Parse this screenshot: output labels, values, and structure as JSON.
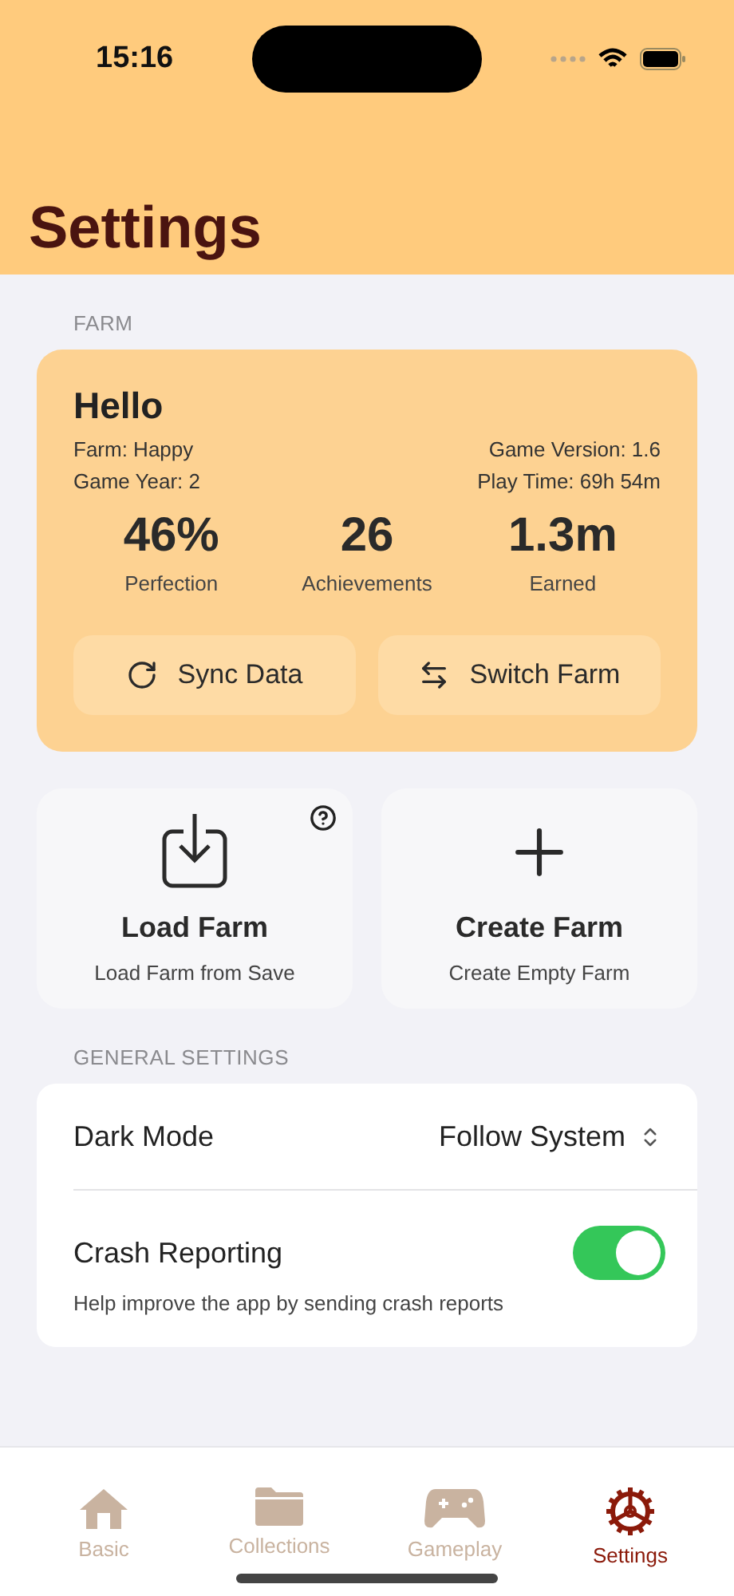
{
  "status_bar": {
    "time": "15:16"
  },
  "title": "Settings",
  "farm_section": {
    "header": "FARM",
    "greeting": "Hello",
    "info_left": [
      "Farm: Happy",
      "Game Year: 2"
    ],
    "info_right": [
      "Game Version: 1.6",
      "Play Time: 69h 54m"
    ],
    "stats": [
      {
        "value": "46%",
        "label": "Perfection"
      },
      {
        "value": "26",
        "label": "Achievements"
      },
      {
        "value": "1.3m",
        "label": "Earned"
      }
    ],
    "buttons": [
      {
        "kind": "sync",
        "label": "Sync Data"
      },
      {
        "kind": "switch",
        "label": "Switch Farm"
      }
    ]
  },
  "tiles": [
    {
      "kind": "load",
      "title": "Load Farm",
      "subtitle": "Load Farm from Save",
      "help": true
    },
    {
      "kind": "create",
      "title": "Create Farm",
      "subtitle": "Create Empty Farm",
      "help": false
    }
  ],
  "general_settings": {
    "header": "GENERAL SETTINGS",
    "dark_mode": {
      "label": "Dark Mode",
      "value": "Follow System"
    },
    "crash_reporting": {
      "label": "Crash Reporting",
      "on": true,
      "description": "Help improve the app by sending crash reports"
    }
  },
  "tab_bar": [
    {
      "kind": "home",
      "label": "Basic",
      "selected": false
    },
    {
      "kind": "folder",
      "label": "Collections",
      "selected": false
    },
    {
      "kind": "gamepad",
      "label": "Gameplay",
      "selected": false
    },
    {
      "kind": "gear",
      "label": "Settings",
      "selected": true
    }
  ]
}
